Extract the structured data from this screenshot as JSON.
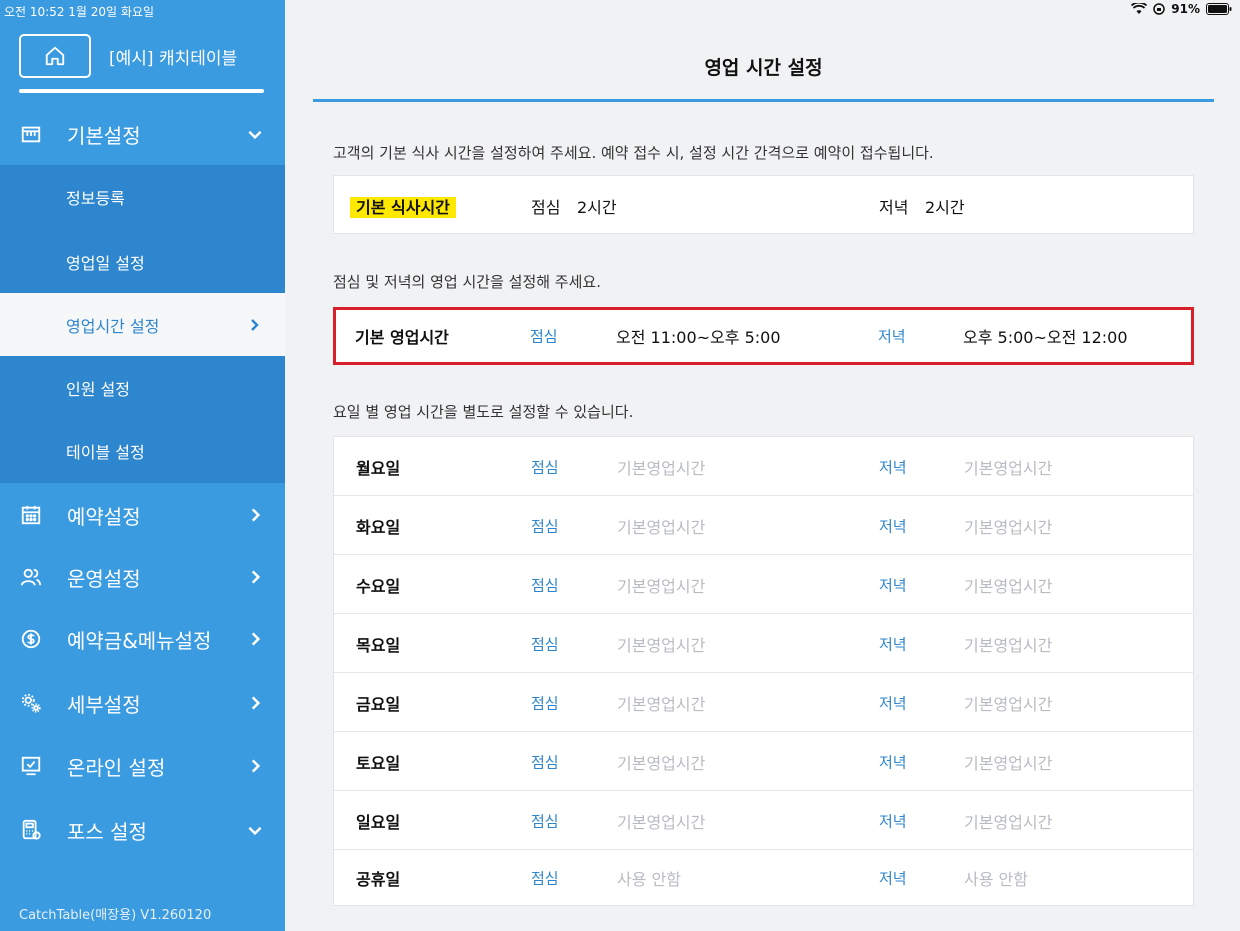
{
  "status_bar": {
    "time_date": "오전 10:52  1월 20일 화요일",
    "battery": "91%"
  },
  "sidebar": {
    "store_name": "[예시] 캐치테이블",
    "menus": [
      {
        "label": "기본설정",
        "icon": "store-icon",
        "chevron": "down"
      },
      {
        "label": "예약설정",
        "icon": "calendar-icon",
        "chevron": "right"
      },
      {
        "label": "운영설정",
        "icon": "users-icon",
        "chevron": "right"
      },
      {
        "label": "예약금&메뉴설정",
        "icon": "dollar-icon",
        "chevron": "right"
      },
      {
        "label": "세부설정",
        "icon": "gears-icon",
        "chevron": "right"
      },
      {
        "label": "온라인 설정",
        "icon": "monitor-check-icon",
        "chevron": "right"
      },
      {
        "label": "포스 설정",
        "icon": "pos-icon",
        "chevron": "down"
      }
    ],
    "submenu": [
      {
        "label": "정보등록"
      },
      {
        "label": "영업일 설정"
      },
      {
        "label": "영업시간 설정"
      },
      {
        "label": "인원 설정"
      },
      {
        "label": "테이블 설정"
      }
    ],
    "version": "CatchTable(매장용) V1.260120"
  },
  "main": {
    "title": "영업 시간 설정",
    "desc1": "고객의 기본 식사 시간을 설정하여 주세요. 예약 접수 시, 설정 시간 간격으로 예약이 접수됩니다.",
    "meal": {
      "label": "기본 식사시간",
      "lunch_label": "점심",
      "lunch_value": "2시간",
      "dinner_label": "저녁",
      "dinner_value": "2시간"
    },
    "desc2": "점심 및 저녁의 영업 시간을 설정해 주세요.",
    "basic_hours": {
      "label": "기본 영업시간",
      "lunch_label": "점심",
      "lunch_value": "오전 11:00~오후 5:00",
      "dinner_label": "저녁",
      "dinner_value": "오후 5:00~오전 12:00"
    },
    "desc3": "요일 별 영업 시간을 별도로 설정할 수 있습니다.",
    "days": [
      {
        "day": "월요일",
        "lunch_label": "점심",
        "lunch": "기본영업시간",
        "dinner_label": "저녁",
        "dinner": "기본영업시간"
      },
      {
        "day": "화요일",
        "lunch_label": "점심",
        "lunch": "기본영업시간",
        "dinner_label": "저녁",
        "dinner": "기본영업시간"
      },
      {
        "day": "수요일",
        "lunch_label": "점심",
        "lunch": "기본영업시간",
        "dinner_label": "저녁",
        "dinner": "기본영업시간"
      },
      {
        "day": "목요일",
        "lunch_label": "점심",
        "lunch": "기본영업시간",
        "dinner_label": "저녁",
        "dinner": "기본영업시간"
      },
      {
        "day": "금요일",
        "lunch_label": "점심",
        "lunch": "기본영업시간",
        "dinner_label": "저녁",
        "dinner": "기본영업시간"
      },
      {
        "day": "토요일",
        "lunch_label": "점심",
        "lunch": "기본영업시간",
        "dinner_label": "저녁",
        "dinner": "기본영업시간"
      },
      {
        "day": "일요일",
        "lunch_label": "점심",
        "lunch": "기본영업시간",
        "dinner_label": "저녁",
        "dinner": "기본영업시간"
      },
      {
        "day": "공휴일",
        "lunch_label": "점심",
        "lunch": "사용 안함",
        "dinner_label": "저녁",
        "dinner": "사용 안함"
      }
    ]
  },
  "colors": {
    "sidebar": "#3b9be0",
    "submenu": "#2d86ce",
    "accent": "#2d86ce",
    "highlight": "#ffe800",
    "selection_border": "#d9202a"
  }
}
